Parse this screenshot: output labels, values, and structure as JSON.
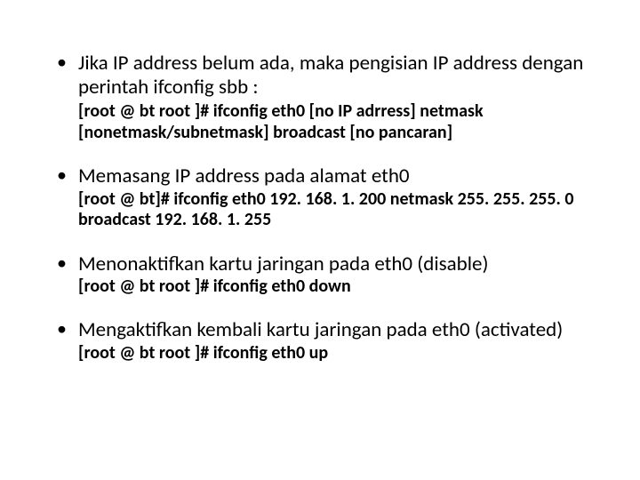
{
  "bullets": [
    {
      "lead": "Jika IP address belum ada, maka pengisian IP address dengan perintah ifconfig sbb :",
      "cmd": "[root @ bt root ]# ifconfig eth0 [no IP adrress] netmask [nonetmask/subnetmask] broadcast [no pancaran]"
    },
    {
      "lead": "Memasang IP address pada alamat eth0",
      "cmd": "[root @ bt]# ifconfig eth0 192. 168. 1. 200 netmask 255. 255. 255. 0 broadcast 192. 168. 1. 255"
    },
    {
      "lead": "Menonaktifkan kartu jaringan pada eth0 (disable)",
      "cmd": "[root @ bt root ]# ifconfig eth0 down"
    },
    {
      "lead": "Mengaktifkan kembali kartu jaringan pada eth0 (activated)",
      "cmd": "[root @ bt root ]# ifconfig eth0 up"
    }
  ]
}
